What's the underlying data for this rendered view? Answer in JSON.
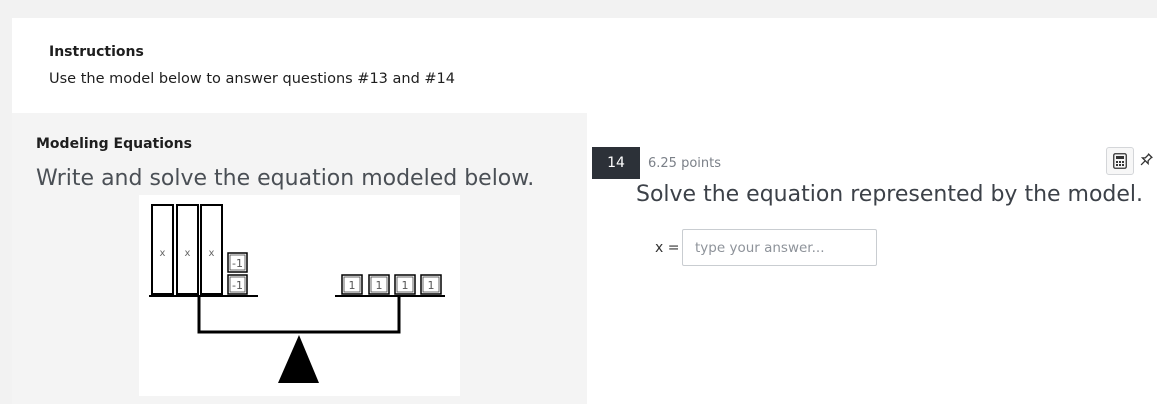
{
  "instructions": {
    "title": "Instructions",
    "text": "Use the model below to answer questions #13 and #14"
  },
  "passage": {
    "title": "Modeling Equations",
    "prompt": "Write and solve the equation modeled below.",
    "model": {
      "left_pan": {
        "x_tiles": [
          "x",
          "x",
          "x"
        ],
        "negative_unit_tiles": [
          "-1",
          "-1"
        ]
      },
      "right_pan": {
        "unit_tiles": [
          "1",
          "1",
          "1",
          "1"
        ]
      }
    }
  },
  "question": {
    "number": "14",
    "points": "6.25 points",
    "prompt": "Solve the equation represented by the model.",
    "answer_label": "x =",
    "answer_placeholder": "type your answer...",
    "answer_value": "",
    "tools": [
      "calculator-icon",
      "pin-icon"
    ]
  }
}
